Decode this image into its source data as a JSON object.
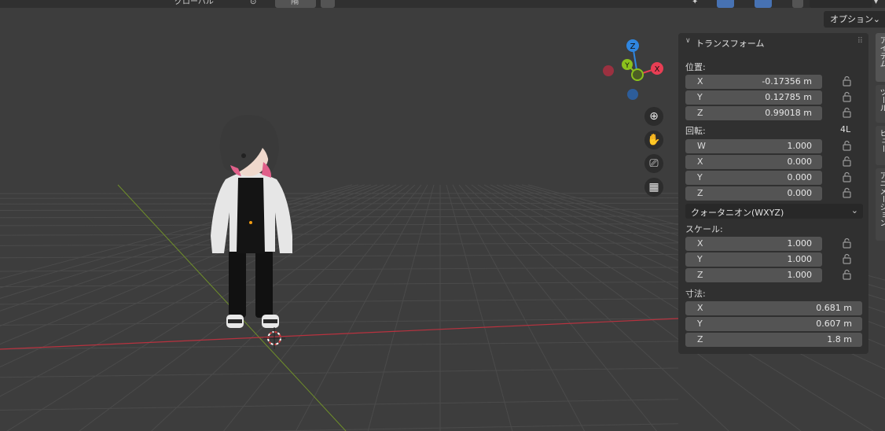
{
  "header": {
    "pivot_label": "グローバル",
    "snap_label": "隔",
    "options_label": "オプション"
  },
  "gizmo": {
    "axis_x": "X",
    "axis_y": "Y",
    "axis_z": "Z",
    "colors": {
      "x": "#e83e54",
      "y": "#8bc11d",
      "z": "#2f86e0",
      "x_neg": "#9b3140",
      "z_neg": "#2d5d9a"
    }
  },
  "nav_icons": [
    "zoom-icon",
    "hand-icon",
    "camera-icon",
    "perspective-grid-icon"
  ],
  "side_tabs": [
    "アイテム",
    "ツール",
    "ビュー",
    "アニメーション"
  ],
  "transform": {
    "title": "トランスフォーム",
    "location_label": "位置:",
    "location": [
      {
        "axis": "X",
        "value": "-0.17356 m"
      },
      {
        "axis": "Y",
        "value": "0.12785 m"
      },
      {
        "axis": "Z",
        "value": "0.99018 m"
      }
    ],
    "rotation_label": "回転:",
    "rotation_mode_badge": "4L",
    "rotation": [
      {
        "axis": "W",
        "value": "1.000"
      },
      {
        "axis": "X",
        "value": "0.000"
      },
      {
        "axis": "Y",
        "value": "0.000"
      },
      {
        "axis": "Z",
        "value": "0.000"
      }
    ],
    "rotation_mode": "クォータニオン(WXYZ)",
    "scale_label": "スケール:",
    "scale": [
      {
        "axis": "X",
        "value": "1.000"
      },
      {
        "axis": "Y",
        "value": "1.000"
      },
      {
        "axis": "Z",
        "value": "1.000"
      }
    ],
    "dimensions_label": "寸法:",
    "dimensions": [
      {
        "axis": "X",
        "value": "0.681 m"
      },
      {
        "axis": "Y",
        "value": "0.607 m"
      },
      {
        "axis": "Z",
        "value": "1.8 m"
      }
    ]
  },
  "colors": {
    "viewport_bg": "#3d3d3d",
    "grid_line": "#4b4b4b",
    "x_axis_line": "#b8323f",
    "y_axis_line": "#6f8f2a",
    "panel_bg": "#303030",
    "field_bg": "#545454"
  }
}
